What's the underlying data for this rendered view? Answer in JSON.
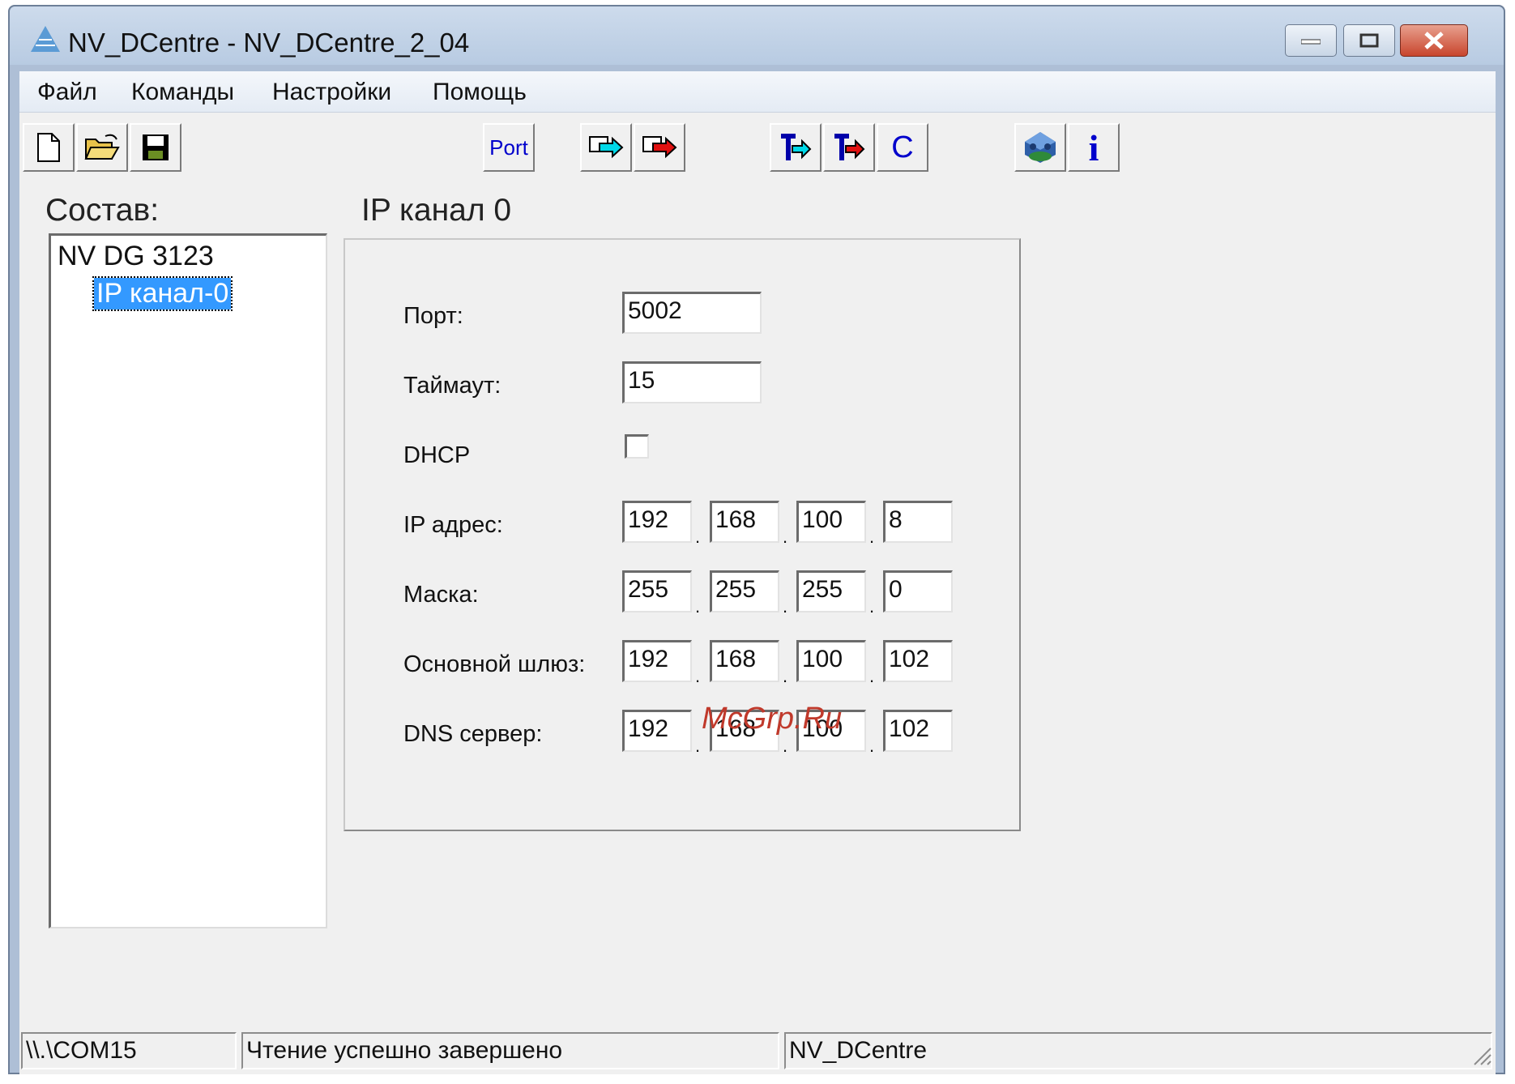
{
  "window": {
    "title": "NV_DCentre - NV_DCentre_2_04"
  },
  "menu": [
    "Файл",
    "Команды",
    "Настройки",
    "Помощь"
  ],
  "toolbar": {
    "port_label": "Port",
    "c_label": "C",
    "info_label": "i"
  },
  "tree": {
    "heading": "Состав:",
    "root": "NV DG 3123",
    "selected_child": "IP канал-0"
  },
  "panel": {
    "heading": "IP канал 0",
    "port": {
      "label": "Порт:",
      "value": "5002"
    },
    "timeout": {
      "label": "Таймаут:",
      "value": "15"
    },
    "dhcp": {
      "label": "DHCP",
      "checked": false
    },
    "ip": {
      "label": "IP адрес:",
      "octets": [
        "192",
        "168",
        "100",
        "8"
      ]
    },
    "mask": {
      "label": "Маска:",
      "octets": [
        "255",
        "255",
        "255",
        "0"
      ]
    },
    "gateway": {
      "label": "Основной шлюз:",
      "octets": [
        "192",
        "168",
        "100",
        "102"
      ]
    },
    "dns": {
      "label": "DNS сервер:",
      "octets": [
        "192",
        "168",
        "100",
        "102"
      ]
    }
  },
  "watermark": "McGrp.Ru",
  "status": {
    "port": "\\\\.\\COM15",
    "message": "Чтение успешно завершено",
    "app": "NV_DCentre"
  },
  "colors": {
    "titlebar": "#cddbec",
    "selection": "#3399ff",
    "close_button": "#c8452d",
    "watermark": "#c0392b"
  },
  "icons": [
    "app-logo-icon",
    "new-file-icon",
    "open-folder-icon",
    "save-disk-icon",
    "port-icon",
    "write-arrow-icon",
    "read-arrow-icon",
    "t-write-icon",
    "t-read-icon",
    "c-icon",
    "network-icon",
    "info-icon"
  ]
}
